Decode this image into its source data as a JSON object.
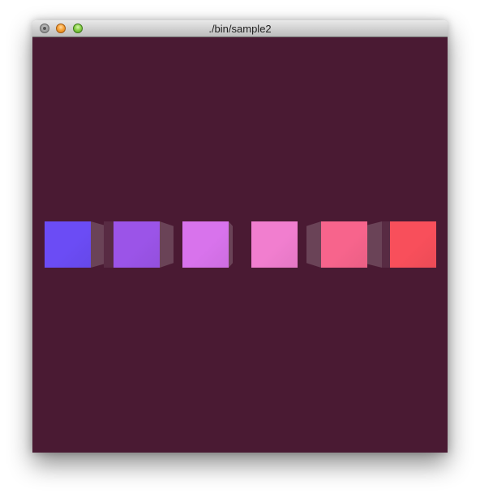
{
  "window": {
    "title": "./bin/sample2"
  },
  "canvas": {
    "background": "#4a1a33"
  },
  "cubes": [
    {
      "name": "cube-1",
      "color": "#6b4cf5"
    },
    {
      "name": "cube-2",
      "color": "#9b54e8"
    },
    {
      "name": "cube-3",
      "color": "#d873ec"
    },
    {
      "name": "cube-4",
      "color": "#f17ecf"
    },
    {
      "name": "cube-5",
      "color": "#f7648c"
    },
    {
      "name": "cube-6",
      "color": "#f84f5b"
    }
  ]
}
